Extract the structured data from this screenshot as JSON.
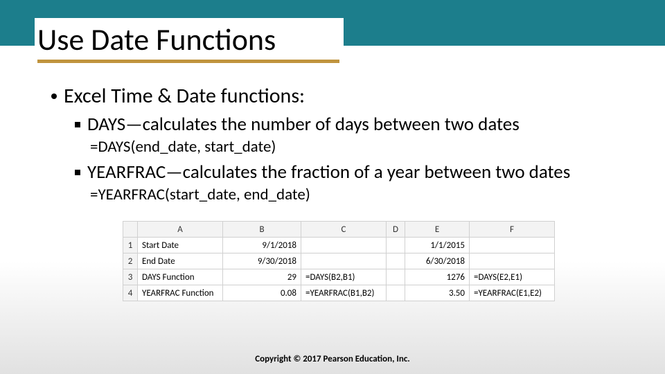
{
  "slide": {
    "title": "Use Date Functions",
    "bullet1": "Excel Time & Date functions:",
    "sub1": "DAYS—calculates the number of days between two dates",
    "formula1": "=DAYS(end_date, start_date)",
    "sub2": "YEARFRAC—calculates the fraction of a year between two dates",
    "formula2": "=YEARFRAC(start_date, end_date)"
  },
  "sheet": {
    "cols": [
      "A",
      "B",
      "C",
      "D",
      "E",
      "F"
    ],
    "rows": [
      {
        "n": "1",
        "A": "Start Date",
        "B": "9/1/2018",
        "C": "",
        "D": "",
        "E": "1/1/2015",
        "F": ""
      },
      {
        "n": "2",
        "A": "End Date",
        "B": "9/30/2018",
        "C": "",
        "D": "",
        "E": "6/30/2018",
        "F": ""
      },
      {
        "n": "3",
        "A": "DAYS Function",
        "B": "29",
        "C": "=DAYS(B2,B1)",
        "D": "",
        "E": "1276",
        "F": "=DAYS(E2,E1)"
      },
      {
        "n": "4",
        "A": "YEARFRAC Function",
        "B": "0.08",
        "C": "=YEARFRAC(B1,B2)",
        "D": "",
        "E": "3.50",
        "F": "=YEARFRAC(E1,E2)"
      }
    ]
  },
  "copyright": "Copyright © 2017 Pearson Education, Inc.",
  "chart_data": {
    "type": "table",
    "title": "Excel sheet example for DAYS and YEARFRAC",
    "columns": [
      "A",
      "B",
      "C",
      "D",
      "E",
      "F"
    ],
    "rows": [
      [
        "Start Date",
        "9/1/2018",
        "",
        "",
        "1/1/2015",
        ""
      ],
      [
        "End Date",
        "9/30/2018",
        "",
        "",
        "6/30/2018",
        ""
      ],
      [
        "DAYS Function",
        29,
        "=DAYS(B2,B1)",
        "",
        1276,
        "=DAYS(E2,E1)"
      ],
      [
        "YEARFRAC Function",
        0.08,
        "=YEARFRAC(B1,B2)",
        "",
        3.5,
        "=YEARFRAC(E1,E2)"
      ]
    ]
  }
}
